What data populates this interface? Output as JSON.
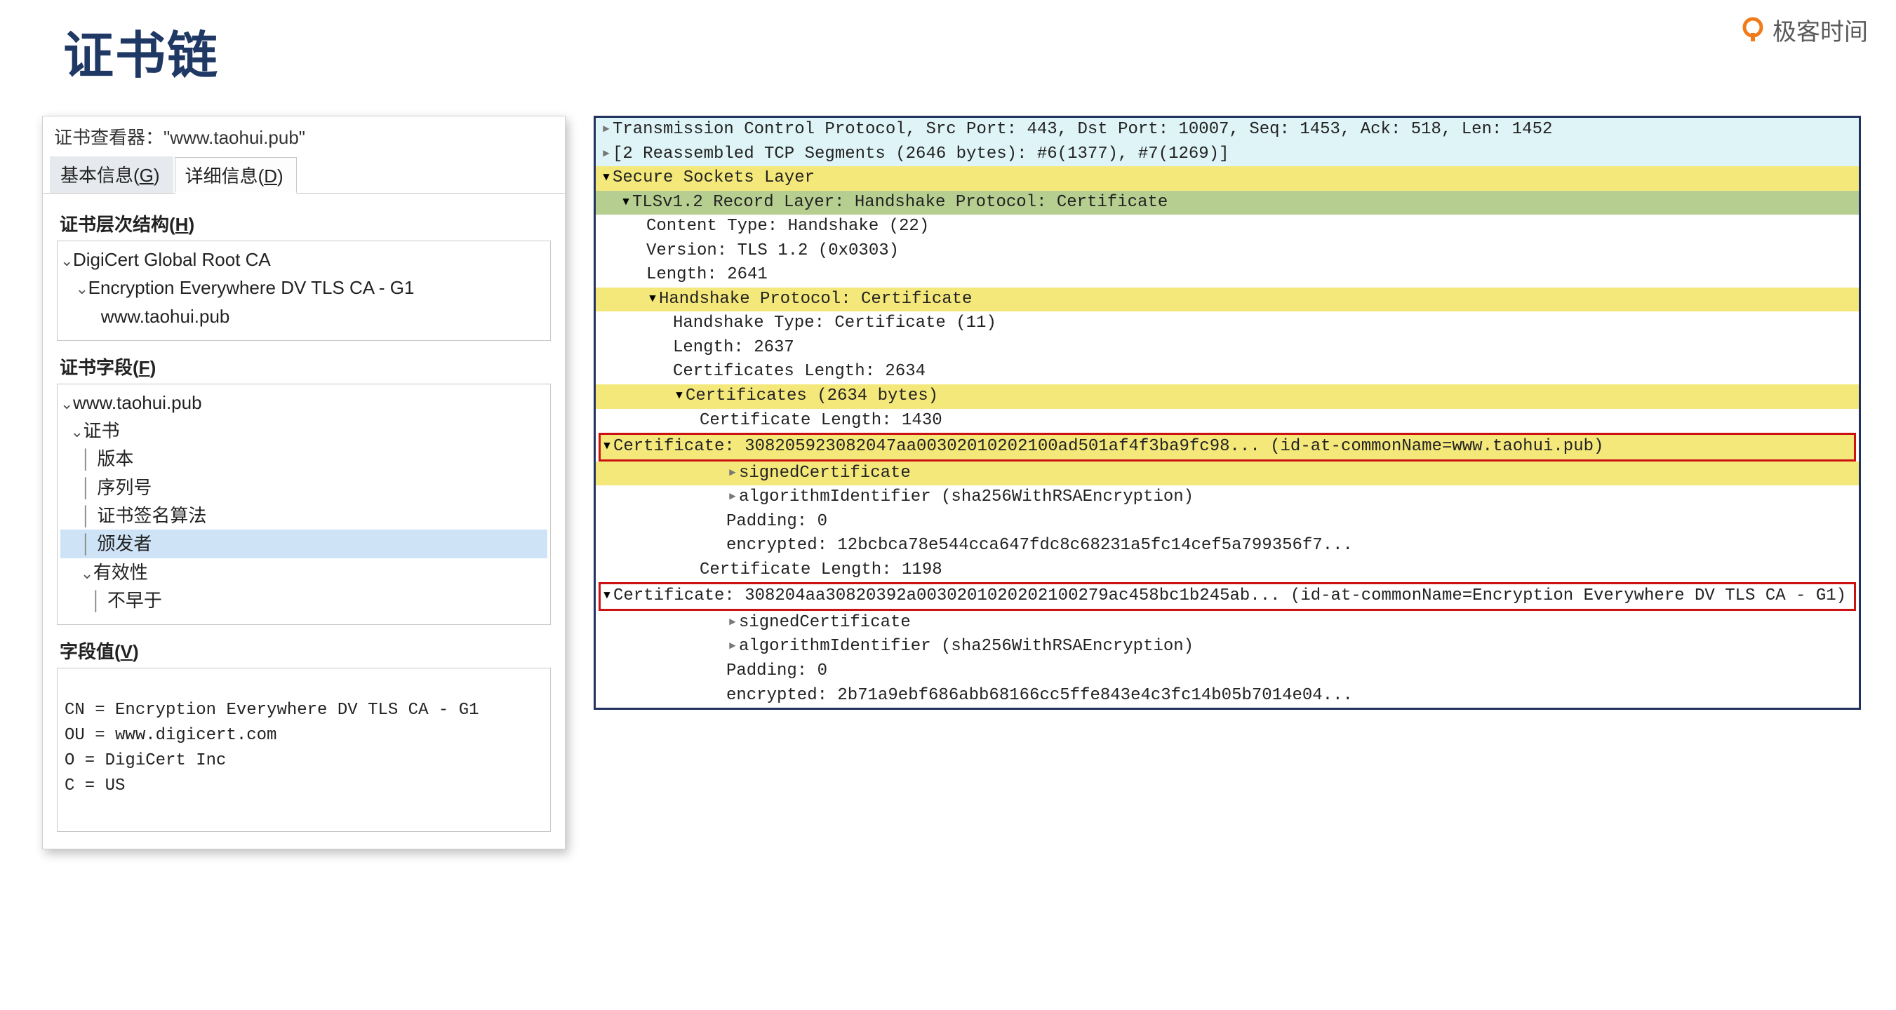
{
  "page": {
    "title": "证书链"
  },
  "brand": {
    "text": "极客时间"
  },
  "cert_viewer": {
    "dialog_title": "证书查看器：\"www.taohui.pub\"",
    "tabs": {
      "basic": {
        "label": "基本信息(",
        "hotkey": "G",
        "suffix": ")"
      },
      "detail": {
        "label": "详细信息(",
        "hotkey": "D",
        "suffix": ")"
      }
    },
    "hierarchy_heading": {
      "label": "证书层次结构(",
      "hotkey": "H",
      "suffix": ")"
    },
    "hierarchy": {
      "root": "DigiCert Global Root CA",
      "inter": "Encryption Everywhere DV TLS CA - G1",
      "leaf": "www.taohui.pub"
    },
    "fields_heading": {
      "label": "证书字段(",
      "hotkey": "F",
      "suffix": ")"
    },
    "fields": {
      "subject": "www.taohui.pub",
      "cert": "证书",
      "version": "版本",
      "serial": "序列号",
      "sig_algo": "证书签名算法",
      "issuer": "颁发者",
      "validity": "有效性",
      "not_before": "不早于"
    },
    "value_heading": {
      "label": "字段值(",
      "hotkey": "V",
      "suffix": ")"
    },
    "value_lines": [
      "CN = Encryption Everywhere DV TLS CA - G1",
      "OU = www.digicert.com",
      "O = DigiCert Inc",
      "C = US"
    ]
  },
  "ws": {
    "tcp": "Transmission Control Protocol, Src Port: 443, Dst Port: 10007, Seq: 1453, Ack: 518, Len: 1452",
    "reasm": "[2 Reassembled TCP Segments (2646 bytes): #6(1377), #7(1269)]",
    "ssl": "Secure Sockets Layer",
    "tls_rec": "TLSv1.2 Record Layer: Handshake Protocol: Certificate",
    "content_type": "Content Type: Handshake (22)",
    "version": "Version: TLS 1.2 (0x0303)",
    "length_rec": "Length: 2641",
    "hs_proto": "Handshake Protocol: Certificate",
    "hs_type": "Handshake Type: Certificate (11)",
    "hs_len": "Length: 2637",
    "certs_len": "Certificates Length: 2634",
    "certs_header": "Certificates (2634 bytes)",
    "cert1_len": "Certificate Length: 1430",
    "cert1": "Certificate: 308205923082047aa00302010202100ad501af4f3ba9fc98... (id-at-commonName=www.taohui.pub)",
    "signed_cert": "signedCertificate",
    "algo_id": "algorithmIdentifier (sha256WithRSAEncryption)",
    "padding": "Padding: 0",
    "enc1": "encrypted: 12bcbca78e544cca647fdc8c68231a5fc14cef5a799356f7...",
    "cert2_len": "Certificate Length: 1198",
    "cert2": "Certificate: 308204aa30820392a0030201020202100279ac458bc1b245ab... (id-at-commonName=Encryption Everywhere DV TLS CA - G1)",
    "enc2": "encrypted: 2b71a9ebf686abb68166cc5ffe843e4c3fc14b05b7014e04..."
  }
}
